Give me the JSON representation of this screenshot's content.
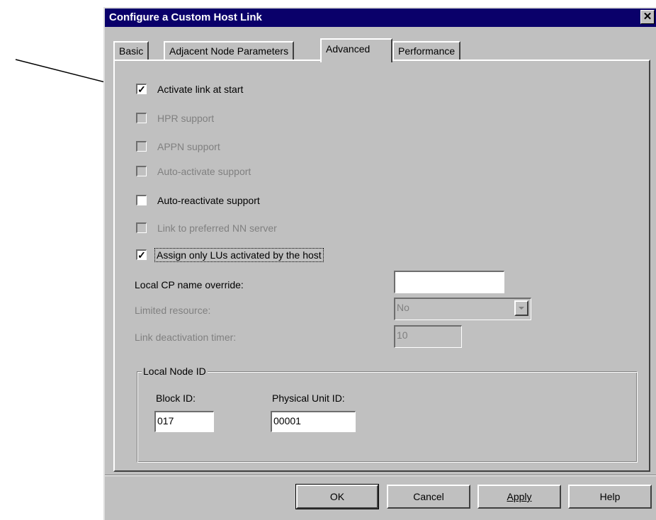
{
  "dialog": {
    "title": "Configure a Custom Host Link",
    "close_glyph": "✕"
  },
  "tabs": [
    {
      "label": "Basic",
      "active": false
    },
    {
      "label": "Adjacent Node Parameters",
      "active": false
    },
    {
      "label": "Advanced",
      "active": true
    },
    {
      "label": "Performance",
      "active": false
    }
  ],
  "checkboxes": [
    {
      "label": "Activate link at start",
      "checked": true,
      "enabled": true
    },
    {
      "label": "HPR support",
      "checked": false,
      "enabled": false
    },
    {
      "label": "APPN support",
      "checked": false,
      "enabled": false
    },
    {
      "label": "Auto-activate support",
      "checked": false,
      "enabled": false
    },
    {
      "label": "Auto-reactivate support",
      "checked": false,
      "enabled": true
    },
    {
      "label": "Link to preferred NN server",
      "checked": false,
      "enabled": false
    },
    {
      "label": "Assign only LUs activated by the host",
      "checked": true,
      "enabled": true
    }
  ],
  "fields": {
    "local_cp": {
      "label": "Local CP name override:",
      "value": ""
    },
    "limited_resource": {
      "label": "Limited resource:",
      "value": "No"
    },
    "deactivation_timer": {
      "label": "Link deactivation timer:",
      "value": "10"
    }
  },
  "local_node_id": {
    "legend": "Local Node ID",
    "block_id": {
      "label": "Block ID:",
      "value": "017"
    },
    "physical_unit_id": {
      "label": "Physical Unit ID:",
      "value": "00001"
    }
  },
  "buttons": {
    "ok": "OK",
    "cancel": "Cancel",
    "apply": "Apply",
    "help": "Help"
  },
  "colors": {
    "title_bar": "#0a006a",
    "dialog_face": "#c0c0c0",
    "disabled_text": "#808080"
  }
}
